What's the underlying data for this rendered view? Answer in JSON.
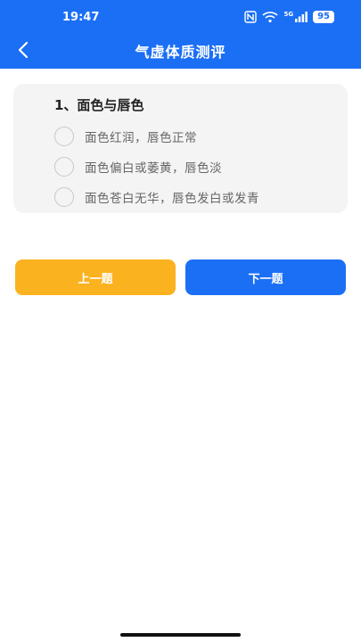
{
  "status_bar": {
    "time": "19:47",
    "network": "5G",
    "battery": "95"
  },
  "header": {
    "title": "气虚体质测评"
  },
  "question": {
    "title": "1、面色与唇色",
    "options": [
      {
        "label": "面色红润，唇色正常"
      },
      {
        "label": "面色偏白或萎黄，唇色淡"
      },
      {
        "label": "面色苍白无华，唇色发白或发青"
      }
    ]
  },
  "buttons": {
    "prev_label": "上一题",
    "next_label": "下一题"
  },
  "colors": {
    "primary": "#1b6ff5",
    "secondary": "#fbb21f",
    "card_bg": "#f4f4f4"
  }
}
